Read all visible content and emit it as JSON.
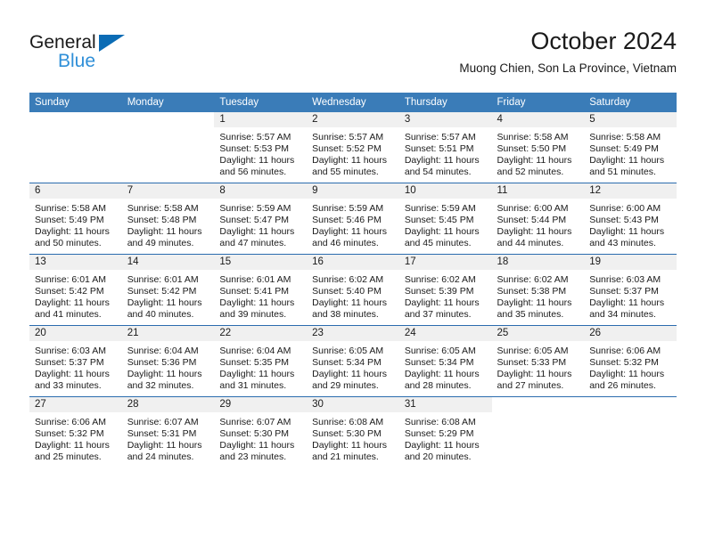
{
  "brand": {
    "name_top": "General",
    "name_bottom": "Blue",
    "triangle_color": "#0b6cb5",
    "blue_text_color": "#2f8fd8"
  },
  "header": {
    "title": "October 2024",
    "subtitle": "Muong Chien, Son La Province, Vietnam"
  },
  "theme": {
    "header_blue": "#3a7cb8",
    "row_separator_blue": "#2b6cae",
    "daynum_band_gray": "#f0f0f0"
  },
  "calendar": {
    "weekday_headers": [
      "Sunday",
      "Monday",
      "Tuesday",
      "Wednesday",
      "Thursday",
      "Friday",
      "Saturday"
    ],
    "weeks": [
      [
        {
          "day": "",
          "lines": []
        },
        {
          "day": "",
          "lines": []
        },
        {
          "day": "1",
          "lines": [
            "Sunrise: 5:57 AM",
            "Sunset: 5:53 PM",
            "Daylight: 11 hours",
            "and 56 minutes."
          ]
        },
        {
          "day": "2",
          "lines": [
            "Sunrise: 5:57 AM",
            "Sunset: 5:52 PM",
            "Daylight: 11 hours",
            "and 55 minutes."
          ]
        },
        {
          "day": "3",
          "lines": [
            "Sunrise: 5:57 AM",
            "Sunset: 5:51 PM",
            "Daylight: 11 hours",
            "and 54 minutes."
          ]
        },
        {
          "day": "4",
          "lines": [
            "Sunrise: 5:58 AM",
            "Sunset: 5:50 PM",
            "Daylight: 11 hours",
            "and 52 minutes."
          ]
        },
        {
          "day": "5",
          "lines": [
            "Sunrise: 5:58 AM",
            "Sunset: 5:49 PM",
            "Daylight: 11 hours",
            "and 51 minutes."
          ]
        }
      ],
      [
        {
          "day": "6",
          "lines": [
            "Sunrise: 5:58 AM",
            "Sunset: 5:49 PM",
            "Daylight: 11 hours",
            "and 50 minutes."
          ]
        },
        {
          "day": "7",
          "lines": [
            "Sunrise: 5:58 AM",
            "Sunset: 5:48 PM",
            "Daylight: 11 hours",
            "and 49 minutes."
          ]
        },
        {
          "day": "8",
          "lines": [
            "Sunrise: 5:59 AM",
            "Sunset: 5:47 PM",
            "Daylight: 11 hours",
            "and 47 minutes."
          ]
        },
        {
          "day": "9",
          "lines": [
            "Sunrise: 5:59 AM",
            "Sunset: 5:46 PM",
            "Daylight: 11 hours",
            "and 46 minutes."
          ]
        },
        {
          "day": "10",
          "lines": [
            "Sunrise: 5:59 AM",
            "Sunset: 5:45 PM",
            "Daylight: 11 hours",
            "and 45 minutes."
          ]
        },
        {
          "day": "11",
          "lines": [
            "Sunrise: 6:00 AM",
            "Sunset: 5:44 PM",
            "Daylight: 11 hours",
            "and 44 minutes."
          ]
        },
        {
          "day": "12",
          "lines": [
            "Sunrise: 6:00 AM",
            "Sunset: 5:43 PM",
            "Daylight: 11 hours",
            "and 43 minutes."
          ]
        }
      ],
      [
        {
          "day": "13",
          "lines": [
            "Sunrise: 6:01 AM",
            "Sunset: 5:42 PM",
            "Daylight: 11 hours",
            "and 41 minutes."
          ]
        },
        {
          "day": "14",
          "lines": [
            "Sunrise: 6:01 AM",
            "Sunset: 5:42 PM",
            "Daylight: 11 hours",
            "and 40 minutes."
          ]
        },
        {
          "day": "15",
          "lines": [
            "Sunrise: 6:01 AM",
            "Sunset: 5:41 PM",
            "Daylight: 11 hours",
            "and 39 minutes."
          ]
        },
        {
          "day": "16",
          "lines": [
            "Sunrise: 6:02 AM",
            "Sunset: 5:40 PM",
            "Daylight: 11 hours",
            "and 38 minutes."
          ]
        },
        {
          "day": "17",
          "lines": [
            "Sunrise: 6:02 AM",
            "Sunset: 5:39 PM",
            "Daylight: 11 hours",
            "and 37 minutes."
          ]
        },
        {
          "day": "18",
          "lines": [
            "Sunrise: 6:02 AM",
            "Sunset: 5:38 PM",
            "Daylight: 11 hours",
            "and 35 minutes."
          ]
        },
        {
          "day": "19",
          "lines": [
            "Sunrise: 6:03 AM",
            "Sunset: 5:37 PM",
            "Daylight: 11 hours",
            "and 34 minutes."
          ]
        }
      ],
      [
        {
          "day": "20",
          "lines": [
            "Sunrise: 6:03 AM",
            "Sunset: 5:37 PM",
            "Daylight: 11 hours",
            "and 33 minutes."
          ]
        },
        {
          "day": "21",
          "lines": [
            "Sunrise: 6:04 AM",
            "Sunset: 5:36 PM",
            "Daylight: 11 hours",
            "and 32 minutes."
          ]
        },
        {
          "day": "22",
          "lines": [
            "Sunrise: 6:04 AM",
            "Sunset: 5:35 PM",
            "Daylight: 11 hours",
            "and 31 minutes."
          ]
        },
        {
          "day": "23",
          "lines": [
            "Sunrise: 6:05 AM",
            "Sunset: 5:34 PM",
            "Daylight: 11 hours",
            "and 29 minutes."
          ]
        },
        {
          "day": "24",
          "lines": [
            "Sunrise: 6:05 AM",
            "Sunset: 5:34 PM",
            "Daylight: 11 hours",
            "and 28 minutes."
          ]
        },
        {
          "day": "25",
          "lines": [
            "Sunrise: 6:05 AM",
            "Sunset: 5:33 PM",
            "Daylight: 11 hours",
            "and 27 minutes."
          ]
        },
        {
          "day": "26",
          "lines": [
            "Sunrise: 6:06 AM",
            "Sunset: 5:32 PM",
            "Daylight: 11 hours",
            "and 26 minutes."
          ]
        }
      ],
      [
        {
          "day": "27",
          "lines": [
            "Sunrise: 6:06 AM",
            "Sunset: 5:32 PM",
            "Daylight: 11 hours",
            "and 25 minutes."
          ]
        },
        {
          "day": "28",
          "lines": [
            "Sunrise: 6:07 AM",
            "Sunset: 5:31 PM",
            "Daylight: 11 hours",
            "and 24 minutes."
          ]
        },
        {
          "day": "29",
          "lines": [
            "Sunrise: 6:07 AM",
            "Sunset: 5:30 PM",
            "Daylight: 11 hours",
            "and 23 minutes."
          ]
        },
        {
          "day": "30",
          "lines": [
            "Sunrise: 6:08 AM",
            "Sunset: 5:30 PM",
            "Daylight: 11 hours",
            "and 21 minutes."
          ]
        },
        {
          "day": "31",
          "lines": [
            "Sunrise: 6:08 AM",
            "Sunset: 5:29 PM",
            "Daylight: 11 hours",
            "and 20 minutes."
          ]
        },
        {
          "day": "",
          "lines": []
        },
        {
          "day": "",
          "lines": []
        }
      ]
    ]
  }
}
